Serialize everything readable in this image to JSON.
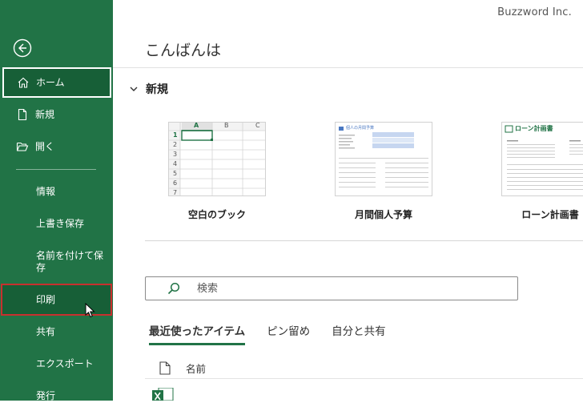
{
  "watermark": "Buzzword Inc.",
  "sidebar": {
    "back_icon": "back-arrow-icon",
    "items": [
      {
        "label": "ホーム",
        "icon": "home-icon"
      },
      {
        "label": "新規",
        "icon": "new-document-icon"
      },
      {
        "label": "開く",
        "icon": "open-folder-icon"
      },
      {
        "label": "情報"
      },
      {
        "label": "上書き保存"
      },
      {
        "label": "名前を付けて保\n存"
      },
      {
        "label": "印刷"
      },
      {
        "label": "共有"
      },
      {
        "label": "エクスポート"
      },
      {
        "label": "発行"
      }
    ],
    "colors": {
      "background": "#217346",
      "selected_border": "#ffffff",
      "highlight_border": "#c8302e"
    }
  },
  "main": {
    "greeting": "こんばんは",
    "new_section": {
      "title": "新規",
      "templates": [
        {
          "label": "空白のブック",
          "columns": [
            "A",
            "B",
            "C"
          ],
          "rows": [
            "1",
            "2",
            "3",
            "4",
            "5",
            "6",
            "7"
          ]
        },
        {
          "label": "月間個人予算",
          "header": "個人の月間予算"
        },
        {
          "label": "ローン計画書",
          "header": "ローン計画書"
        }
      ]
    },
    "search": {
      "placeholder": "検索"
    },
    "tabs": [
      {
        "label": "最近使ったアイテム",
        "active": true
      },
      {
        "label": "ピン留め",
        "active": false
      },
      {
        "label": "自分と共有",
        "active": false
      }
    ],
    "list": {
      "column_name": "名前"
    }
  }
}
